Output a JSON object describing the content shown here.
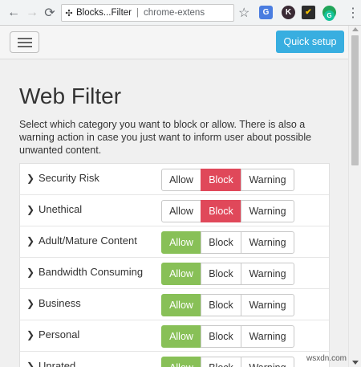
{
  "browser": {
    "tab_title": "Blocks...Filter",
    "url": "chrome-extens",
    "star_glyph": "☆"
  },
  "header": {
    "quick_setup_label": "Quick setup"
  },
  "main": {
    "title": "Web Filter",
    "description": "Select which category you want to block or allow. There is also a warning action in case you just want to inform user about possible unwanted content."
  },
  "actions": {
    "allow": "Allow",
    "block": "Block",
    "warning": "Warning"
  },
  "categories": [
    {
      "name": "Security Risk",
      "selected": "block"
    },
    {
      "name": "Unethical",
      "selected": "block"
    },
    {
      "name": "Adult/Mature Content",
      "selected": "allow"
    },
    {
      "name": "Bandwidth Consuming",
      "selected": "allow"
    },
    {
      "name": "Business",
      "selected": "allow"
    },
    {
      "name": "Personal",
      "selected": "allow"
    },
    {
      "name": "Unrated",
      "selected": "allow"
    }
  ],
  "colors": {
    "block": "#e0485a",
    "allow": "#88c057",
    "accent": "#38aee0"
  },
  "watermark": "wsxdn.com"
}
